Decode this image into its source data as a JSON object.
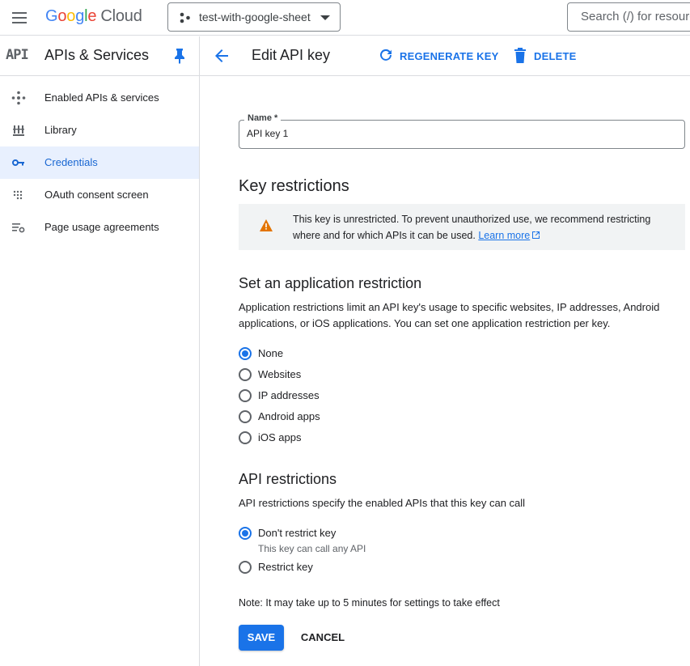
{
  "topbar": {
    "logo_google": [
      "G",
      "o",
      "o",
      "g",
      "l",
      "e"
    ],
    "logo_cloud": "Cloud",
    "project": "test-with-google-sheet",
    "search_placeholder": "Search (/) for resources"
  },
  "sidebar": {
    "badge": "API",
    "title": "APIs & Services",
    "items": [
      {
        "label": "Enabled APIs & services",
        "icon": "hub-icon",
        "active": false
      },
      {
        "label": "Library",
        "icon": "library-icon",
        "active": false
      },
      {
        "label": "Credentials",
        "icon": "key-icon",
        "active": true
      },
      {
        "label": "OAuth consent screen",
        "icon": "consent-icon",
        "active": false
      },
      {
        "label": "Page usage agreements",
        "icon": "settings-list-icon",
        "active": false
      }
    ]
  },
  "header": {
    "title": "Edit API key",
    "regenerate_label": "REGENERATE KEY",
    "delete_label": "DELETE"
  },
  "form": {
    "name_label": "Name *",
    "name_value": "API key 1",
    "key_restrictions_title": "Key restrictions",
    "warning_text": "This key is unrestricted. To prevent unauthorized use, we recommend restricting where and for which APIs it can be used.",
    "warning_link": "Learn more",
    "app_restriction_title": "Set an application restriction",
    "app_restriction_desc": "Application restrictions limit an API key's usage to specific websites, IP addresses, Android applications, or iOS applications. You can set one application restriction per key.",
    "app_options": [
      {
        "label": "None",
        "checked": true
      },
      {
        "label": "Websites",
        "checked": false
      },
      {
        "label": "IP addresses",
        "checked": false
      },
      {
        "label": "Android apps",
        "checked": false
      },
      {
        "label": "iOS apps",
        "checked": false
      }
    ],
    "api_restriction_title": "API restrictions",
    "api_restriction_desc": "API restrictions specify the enabled APIs that this key can call",
    "api_options": [
      {
        "label": "Don't restrict key",
        "checked": true,
        "sub": "This key can call any API"
      },
      {
        "label": "Restrict key",
        "checked": false,
        "sub": ""
      }
    ],
    "note": "Note: It may take up to 5 minutes for settings to take effect",
    "save_label": "SAVE",
    "cancel_label": "CANCEL"
  },
  "colors": {
    "accent": "#1a73e8",
    "active_nav_bg": "#e8f0fe",
    "warning": "#e37400"
  }
}
